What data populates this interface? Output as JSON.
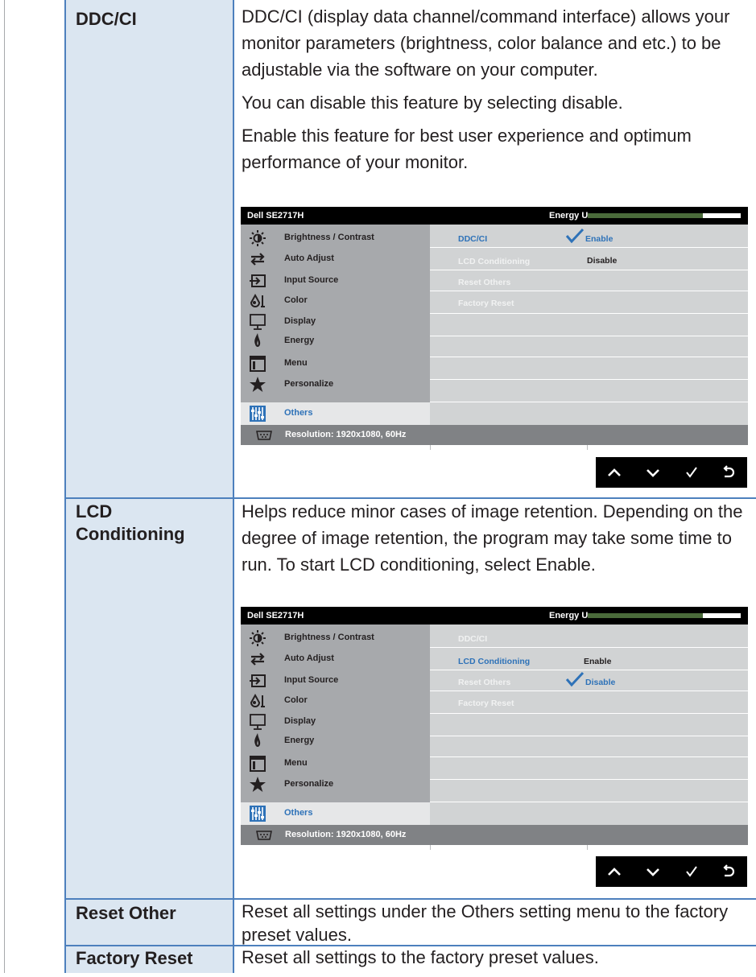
{
  "rows": [
    {
      "term": "DDC/CI",
      "paragraphs": [
        "DDC/CI (display data channel/command interface) allows your monitor parameters (brightness, color balance and etc.) to be adjustable via the software on your computer.",
        "You can disable this feature by selecting disable.",
        "Enable this feature for best user experience and optimum performance of your monitor."
      ]
    },
    {
      "term_line1": "LCD",
      "term_line2": "Conditioning",
      "paragraphs": [
        "Helps reduce minor cases of image retention. Depending on the degree of image retention, the program may take some time to run. To start LCD conditioning, select Enable."
      ]
    },
    {
      "term": "Reset Other",
      "paragraphs": [
        "Reset all settings under the Others setting menu to the factory preset values."
      ]
    },
    {
      "term": "Factory Reset",
      "paragraphs": [
        "Reset all settings to the factory preset values."
      ]
    }
  ],
  "osd": {
    "model": "Dell SE2717H",
    "energy_label": "Energy Use",
    "energy_level": 0.75,
    "menu": [
      {
        "label": "Brightness / Contrast",
        "icon": "brightness-icon"
      },
      {
        "label": "Auto Adjust",
        "icon": "auto-adjust-icon"
      },
      {
        "label": "Input Source",
        "icon": "input-source-icon"
      },
      {
        "label": "Color",
        "icon": "color-icon"
      },
      {
        "label": "Display",
        "icon": "display-icon"
      },
      {
        "label": "Energy",
        "icon": "energy-icon"
      },
      {
        "label": "Menu",
        "icon": "menu-icon"
      },
      {
        "label": "Personalize",
        "icon": "star-icon"
      },
      {
        "label": "Others",
        "icon": "others-icon"
      }
    ],
    "submenu": [
      "DDC/CI",
      "LCD Conditioning",
      "Reset Others",
      "Factory Reset"
    ],
    "status": "Resolution: 1920x1080, 60Hz",
    "option_enable": "Enable",
    "option_disable": "Disable",
    "accent_color": "#2e72b8",
    "nav_icons": [
      "up-arrow-icon",
      "down-arrow-icon",
      "check-icon",
      "back-icon"
    ]
  }
}
